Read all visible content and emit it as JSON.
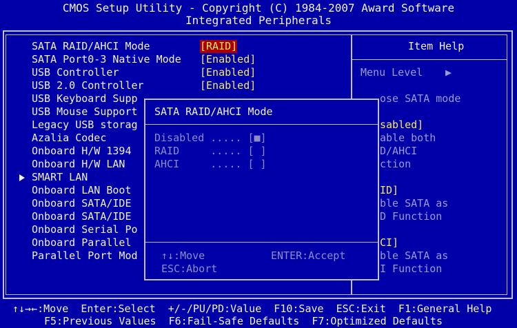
{
  "header": {
    "title": "CMOS Setup Utility - Copyright (C) 1984-2007 Award Software",
    "subtitle": "Integrated Peripherals"
  },
  "items": [
    {
      "label": "SATA RAID/AHCI Mode",
      "value": "[RAID]",
      "selected": true
    },
    {
      "label": "SATA Port0-3 Native Mode",
      "value": "[Enabled]"
    },
    {
      "label": "USB Controller",
      "value": "[Enabled]"
    },
    {
      "label": "USB 2.0 Controller",
      "value": "[Enabled]"
    },
    {
      "label": "USB Keyboard Supp"
    },
    {
      "label": "USB Mouse Support"
    },
    {
      "label": "Legacy USB storag"
    },
    {
      "label": "Azalia Codec"
    },
    {
      "label": "Onboard H/W 1394"
    },
    {
      "label": "Onboard H/W LAN"
    },
    {
      "label": "SMART LAN",
      "submenu": true
    },
    {
      "label": "Onboard LAN Boot"
    },
    {
      "label": "Onboard SATA/IDE"
    },
    {
      "label": "Onboard SATA/IDE"
    },
    {
      "label": "Onboard Serial Po"
    },
    {
      "label": "Onboard Parallel"
    },
    {
      "label": "Parallel Port Mod"
    }
  ],
  "help": {
    "title": "Item Help",
    "menu_level": "Menu Level",
    "lines": [
      {
        "text": "ose SATA mode",
        "style": "help-text"
      },
      {
        "text": "sabled]",
        "style": "help-yellow"
      },
      {
        "text": "able both",
        "style": "help-text"
      },
      {
        "text": "D/AHCI",
        "style": "help-text"
      },
      {
        "text": "ction",
        "style": "help-text"
      },
      {
        "text": "ID]",
        "style": "help-yellow"
      },
      {
        "text": "ble SATA as",
        "style": "help-text"
      },
      {
        "text": "D Function",
        "style": "help-text"
      },
      {
        "text": "CI]",
        "style": "help-yellow"
      },
      {
        "text": "ble SATA as",
        "style": "help-text"
      },
      {
        "text": "I Function",
        "style": "help-text"
      }
    ]
  },
  "popup": {
    "title": "SATA RAID/AHCI Mode",
    "options": [
      {
        "text": "Disabled ..... [■]"
      },
      {
        "text": "RAID     ..... [ ]"
      },
      {
        "text": "AHCI     ..... [ ]"
      }
    ],
    "hint_move": "↑↓:Move",
    "hint_accept": "ENTER:Accept",
    "hint_abort": "ESC:Abort"
  },
  "footer": {
    "line1": "↑↓→←:Move  Enter:Select  +/-/PU/PD:Value  F10:Save  ESC:Exit  F1:General Help",
    "line2": "F5:Previous Values  F6:Fail-Safe Defaults  F7:Optimized Defaults"
  },
  "colors": {
    "background": "#0000a8",
    "value": "#f8e860",
    "selected_bg": "#a80000",
    "help_text": "#9a9ad8"
  }
}
